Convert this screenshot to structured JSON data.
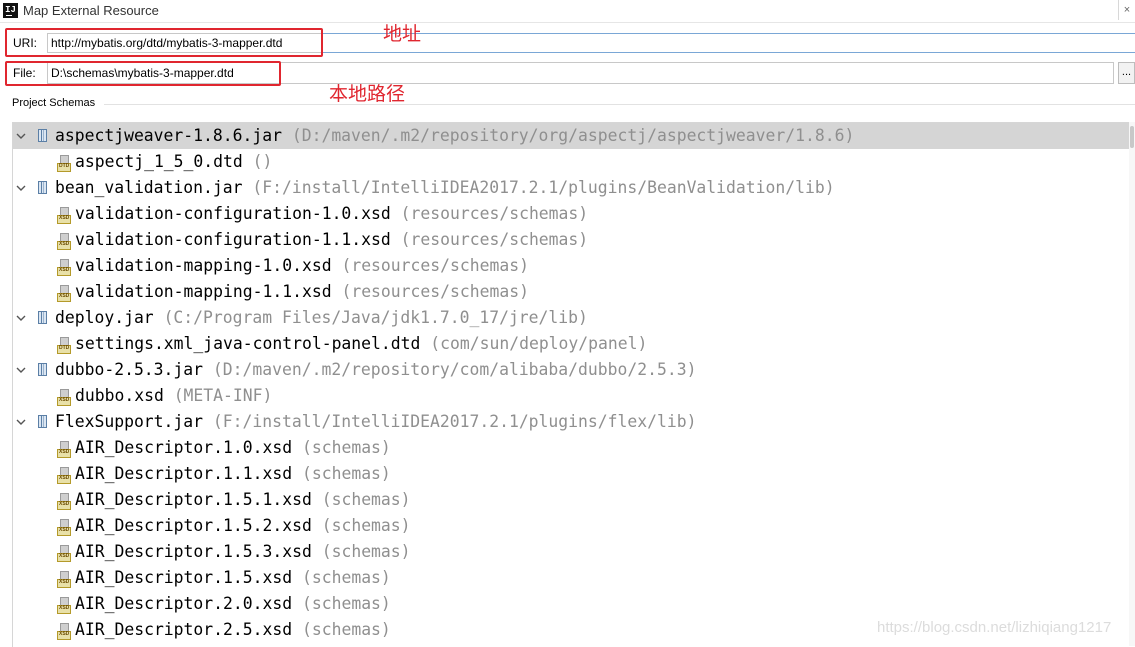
{
  "window": {
    "title": "Map External Resource",
    "close_glyph": "×"
  },
  "uri": {
    "label": "URI:",
    "value": "http://mybatis.org/dtd/mybatis-3-mapper.dtd"
  },
  "file": {
    "label": "File:",
    "value": "D:\\schemas\\mybatis-3-mapper.dtd",
    "browse_label": "..."
  },
  "annotations": {
    "address": "地址",
    "local_path": "本地路径",
    "color": "#e0262f"
  },
  "project_schemas": {
    "title": "Project Schemas",
    "rows": [
      {
        "kind": "jar",
        "name": "aspectjweaver-1.8.6.jar",
        "path": "(D:/maven/.m2/repository/org/aspectj/aspectjweaver/1.8.6)",
        "selected": true
      },
      {
        "kind": "file",
        "icon": "DTD",
        "name": "aspectj_1_5_0.dtd",
        "path": "()"
      },
      {
        "kind": "jar",
        "name": "bean_validation.jar",
        "path": "(F:/install/IntelliIDEA2017.2.1/plugins/BeanValidation/lib)"
      },
      {
        "kind": "file",
        "icon": "XSD",
        "name": "validation-configuration-1.0.xsd",
        "path": "(resources/schemas)"
      },
      {
        "kind": "file",
        "icon": "XSD",
        "name": "validation-configuration-1.1.xsd",
        "path": "(resources/schemas)"
      },
      {
        "kind": "file",
        "icon": "XSD",
        "name": "validation-mapping-1.0.xsd",
        "path": "(resources/schemas)"
      },
      {
        "kind": "file",
        "icon": "XSD",
        "name": "validation-mapping-1.1.xsd",
        "path": "(resources/schemas)"
      },
      {
        "kind": "jar",
        "name": "deploy.jar",
        "path": "(C:/Program Files/Java/jdk1.7.0_17/jre/lib)"
      },
      {
        "kind": "file",
        "icon": "DTD",
        "name": "settings.xml_java-control-panel.dtd",
        "path": "(com/sun/deploy/panel)"
      },
      {
        "kind": "jar",
        "name": "dubbo-2.5.3.jar",
        "path": "(D:/maven/.m2/repository/com/alibaba/dubbo/2.5.3)"
      },
      {
        "kind": "file",
        "icon": "XSD",
        "name": "dubbo.xsd",
        "path": "(META-INF)"
      },
      {
        "kind": "jar",
        "name": "FlexSupport.jar",
        "path": "(F:/install/IntelliIDEA2017.2.1/plugins/flex/lib)"
      },
      {
        "kind": "file",
        "icon": "XSD",
        "name": "AIR_Descriptor.1.0.xsd",
        "path": "(schemas)"
      },
      {
        "kind": "file",
        "icon": "XSD",
        "name": "AIR_Descriptor.1.1.xsd",
        "path": "(schemas)"
      },
      {
        "kind": "file",
        "icon": "XSD",
        "name": "AIR_Descriptor.1.5.1.xsd",
        "path": "(schemas)"
      },
      {
        "kind": "file",
        "icon": "XSD",
        "name": "AIR_Descriptor.1.5.2.xsd",
        "path": "(schemas)"
      },
      {
        "kind": "file",
        "icon": "XSD",
        "name": "AIR_Descriptor.1.5.3.xsd",
        "path": "(schemas)"
      },
      {
        "kind": "file",
        "icon": "XSD",
        "name": "AIR_Descriptor.1.5.xsd",
        "path": "(schemas)"
      },
      {
        "kind": "file",
        "icon": "XSD",
        "name": "AIR_Descriptor.2.0.xsd",
        "path": "(schemas)"
      },
      {
        "kind": "file",
        "icon": "XSD",
        "name": "AIR_Descriptor.2.5.xsd",
        "path": "(schemas)"
      }
    ]
  },
  "watermark": "https://blog.csdn.net/lizhiqiang1217"
}
